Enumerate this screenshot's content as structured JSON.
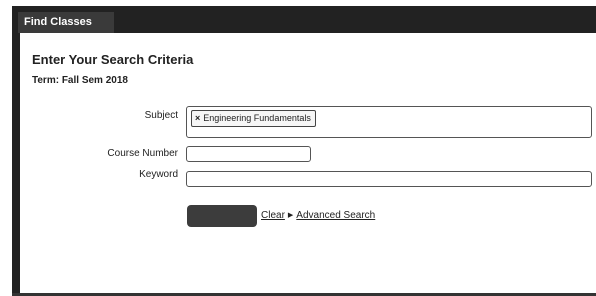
{
  "tabs": [
    {
      "label": "Find Classes",
      "active": true
    }
  ],
  "form": {
    "heading": "Enter Your Search Criteria",
    "term": "Term: Fall Sem 2018",
    "subject": {
      "label": "Subject",
      "selected": [
        {
          "label": "Engineering Fundamentals",
          "remove_icon": "close-icon"
        }
      ]
    },
    "course_number": {
      "label": "Course Number",
      "value": ""
    },
    "keyword": {
      "label": "Keyword",
      "value": ""
    },
    "actions": {
      "search_label": "",
      "clear_label": "Clear",
      "separator_icon": "triangle-right-icon",
      "advanced_label": "Advanced Search"
    }
  },
  "colors": {
    "frame": "#222222",
    "tab": "#3a3a3a",
    "search_button": "#3c3c3c"
  }
}
